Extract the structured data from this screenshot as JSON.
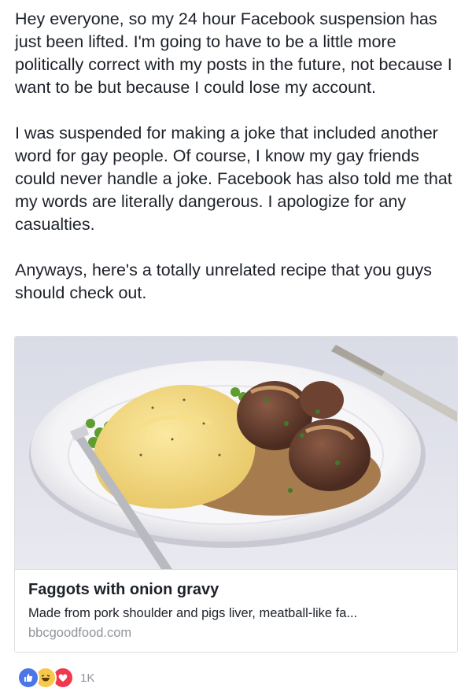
{
  "post": {
    "paragraphs": [
      "Hey everyone, so my 24 hour Facebook suspension has just been lifted. I'm going to have to be a little more politically correct with my posts in the future, not because I want to be but because I could lose my account.",
      "I was suspended for making a joke that included another word for gay people. Of course, I know my gay friends could never handle a joke. Facebook has also told me that my words are literally dangerous. I apologize for any casualties.",
      "Anyways, here's a totally unrelated recipe that you guys should check out."
    ]
  },
  "link_card": {
    "title": "Faggots with onion gravy",
    "description": "Made from pork shoulder and pigs liver, meatball-like fa...",
    "domain": "bbcgoodfood.com",
    "image_icon": "food-plate-photo"
  },
  "reactions": {
    "icons": [
      "like-icon",
      "haha-icon",
      "love-icon"
    ],
    "count": "1K",
    "colors": {
      "like": "#4a76e8",
      "haha": "#f7c84b",
      "love": "#f0384f"
    }
  }
}
